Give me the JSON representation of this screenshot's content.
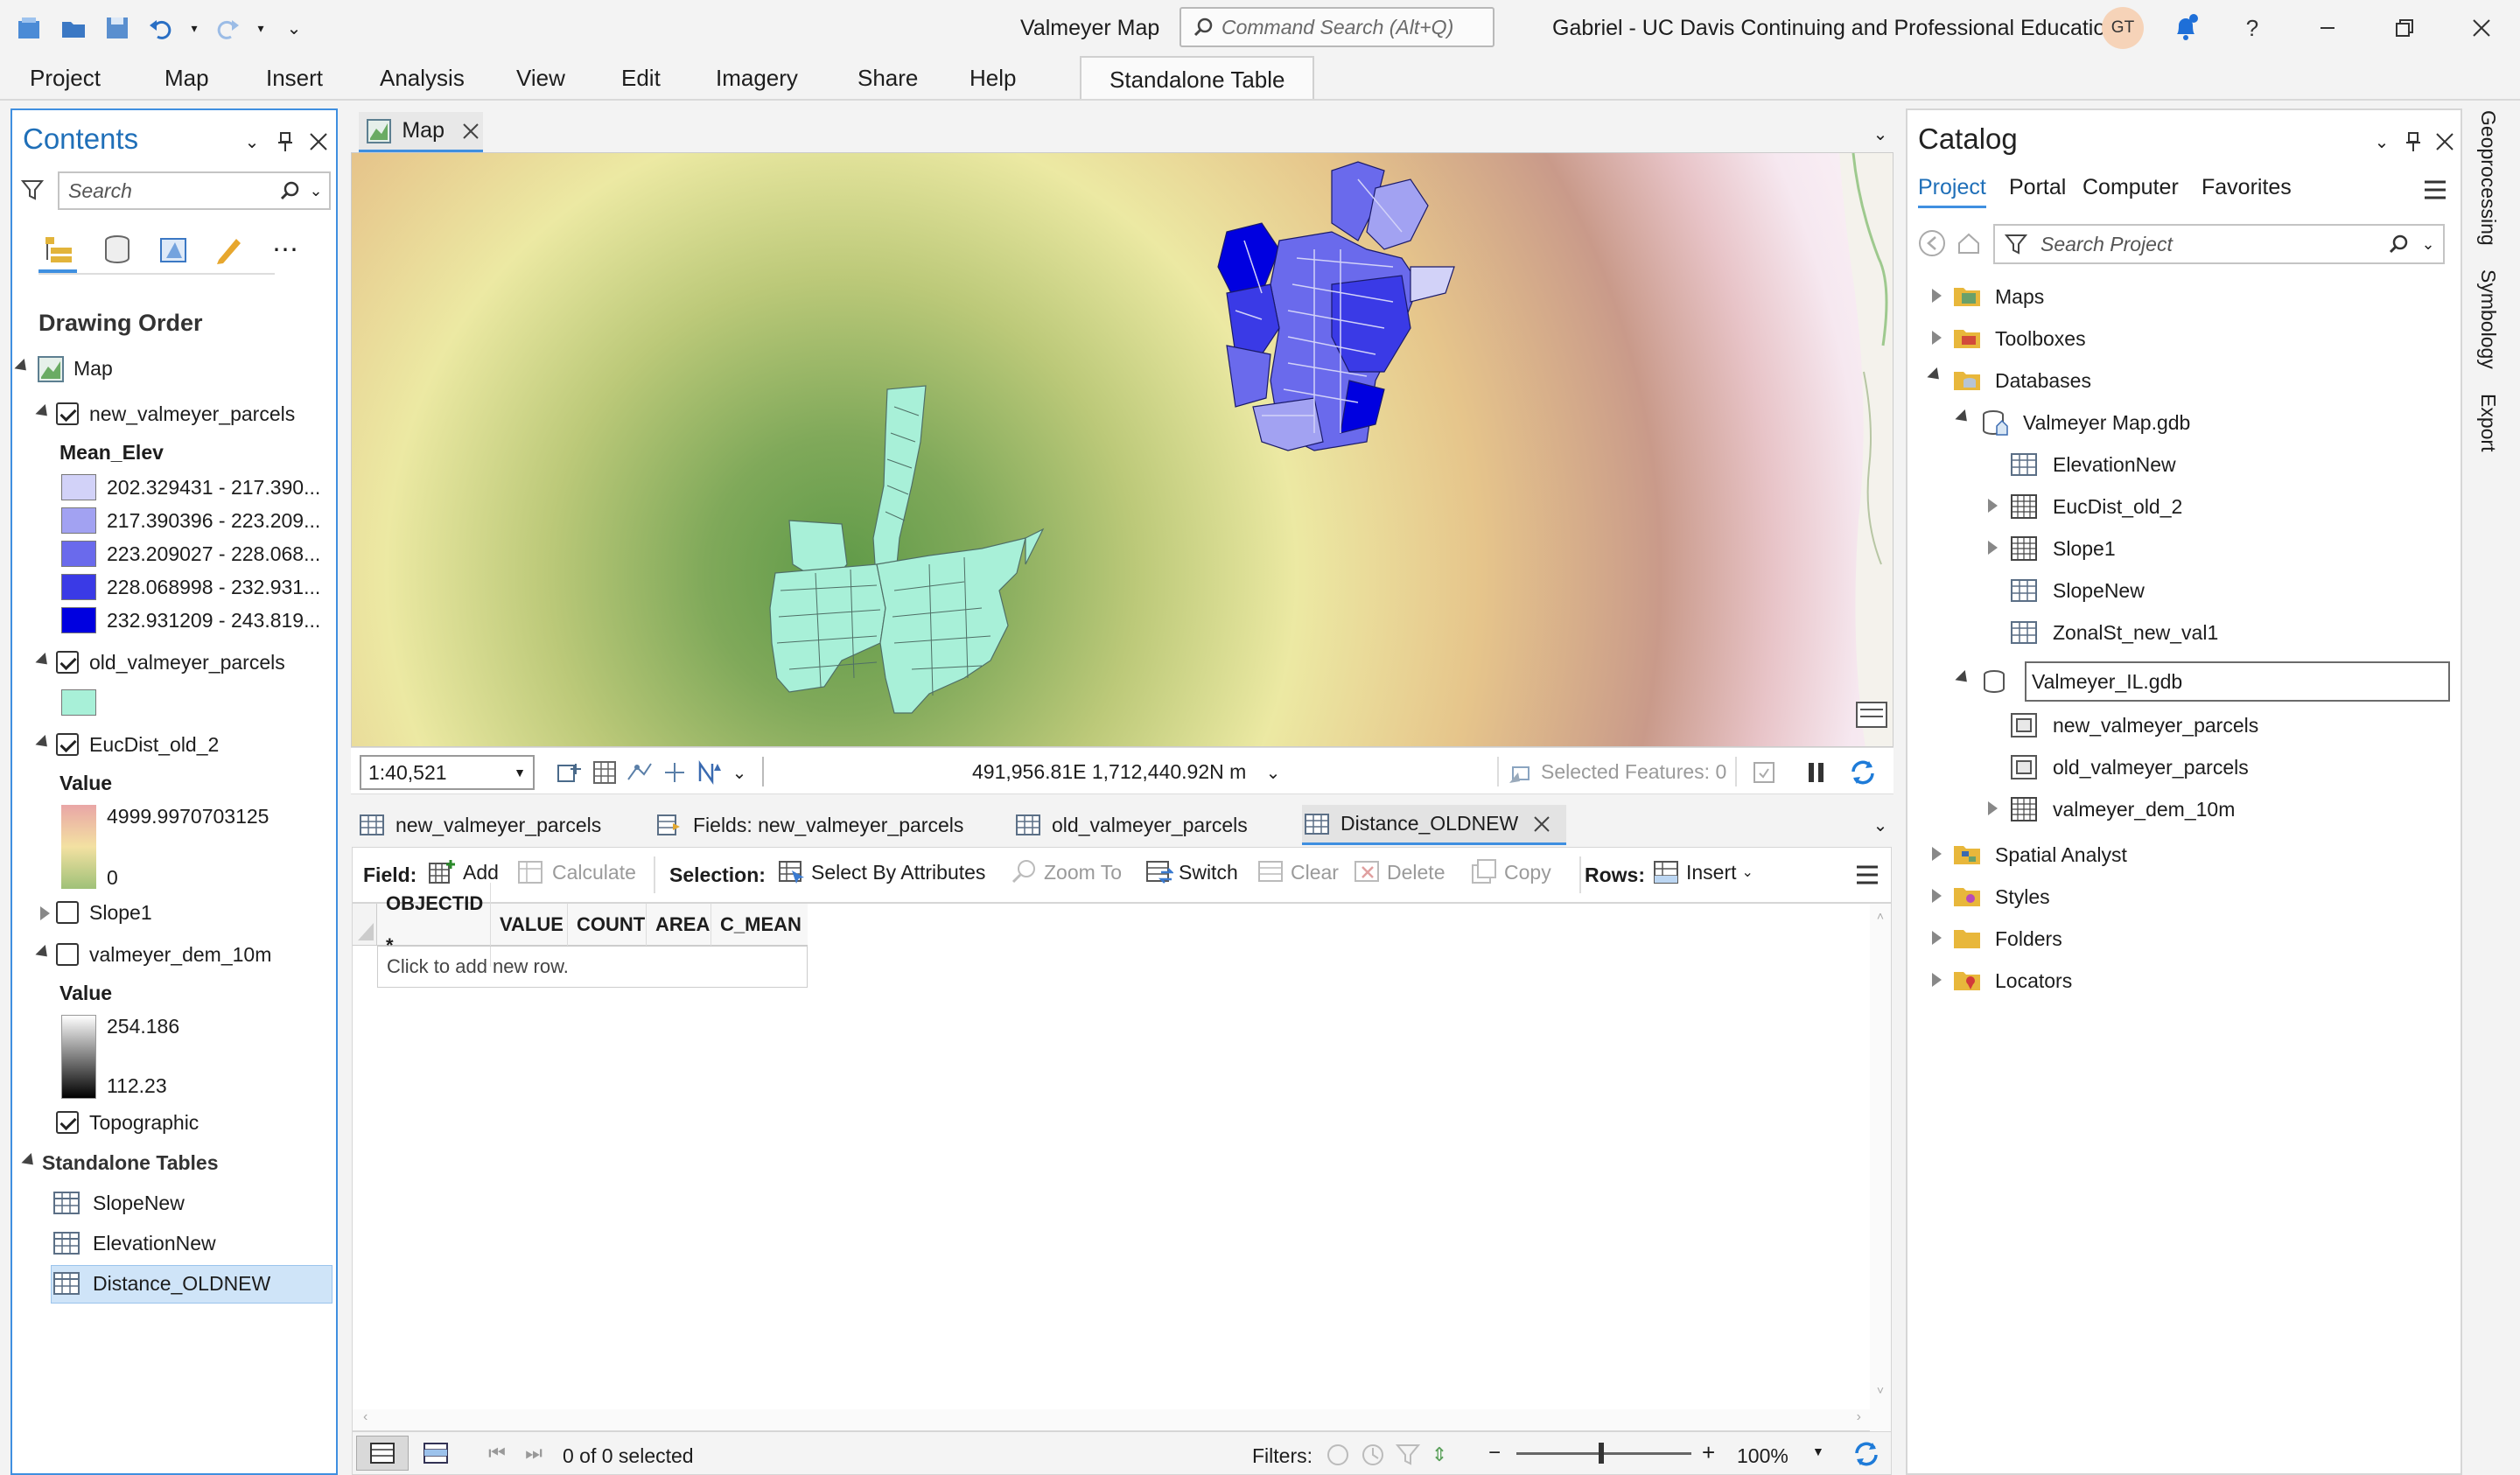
{
  "window": {
    "app_title": "Valmeyer Map",
    "command_search_placeholder": "Command Search (Alt+Q)",
    "user_name": "Gabriel - UC Davis Continuing and Professional Education",
    "user_initials": "GT"
  },
  "ribbon": {
    "tabs": [
      "Project",
      "Map",
      "Insert",
      "Analysis",
      "View",
      "Edit",
      "Imagery",
      "Share",
      "Help"
    ],
    "contextual_tab": "Standalone Table"
  },
  "contents": {
    "title": "Contents",
    "search_placeholder": "Search",
    "drawing_order": "Drawing Order",
    "map_label": "Map",
    "layers": {
      "new_parcels": {
        "name": "new_valmeyer_parcels",
        "field": "Mean_Elev",
        "classes": [
          {
            "label": "202.329431 - 217.390...",
            "color": "#d2d2f8"
          },
          {
            "label": "217.390396 - 223.209...",
            "color": "#a2a2f2"
          },
          {
            "label": "223.209027 - 228.068...",
            "color": "#6a6aec"
          },
          {
            "label": "228.068998 - 232.931...",
            "color": "#3a3ae6"
          },
          {
            "label": "232.931209 - 243.819...",
            "color": "#0000e0"
          }
        ]
      },
      "old_parcels": {
        "name": "old_valmeyer_parcels",
        "color": "#a8f0d8"
      },
      "eucdist": {
        "name": "EucDist_old_2",
        "value_label": "Value",
        "high": "4999.9970703125",
        "low": "0"
      },
      "slope": {
        "name": "Slope1"
      },
      "dem": {
        "name": "valmeyer_dem_10m",
        "value_label": "Value",
        "high": "254.186",
        "low": "112.23"
      },
      "topo": {
        "name": "Topographic"
      }
    },
    "standalone_tables_label": "Standalone Tables",
    "standalone_tables": [
      "SlopeNew",
      "ElevationNew",
      "Distance_OLDNEW"
    ]
  },
  "map_view": {
    "tab_label": "Map",
    "scale": "1:40,521",
    "coordinates": "491,956.81E 1,712,440.92N m",
    "selected_features": "Selected Features: 0"
  },
  "table_view": {
    "tabs": [
      "new_valmeyer_parcels",
      "Fields: new_valmeyer_parcels",
      "old_valmeyer_parcels",
      "Distance_OLDNEW"
    ],
    "toolbar": {
      "field_label": "Field:",
      "add": "Add",
      "calculate": "Calculate",
      "selection_label": "Selection:",
      "select_by_attributes": "Select By Attributes",
      "zoom_to": "Zoom To",
      "switch": "Switch",
      "clear": "Clear",
      "delete": "Delete",
      "copy": "Copy",
      "rows_label": "Rows:",
      "insert": "Insert"
    },
    "columns": [
      "OBJECTID *",
      "VALUE",
      "COUNT",
      "AREA",
      "C_MEAN"
    ],
    "new_row_hint": "Click to add new row.",
    "footer": {
      "selection_count": "0 of 0 selected",
      "filters_label": "Filters:",
      "zoom_level": "100%"
    }
  },
  "catalog": {
    "title": "Catalog",
    "tabs": [
      "Project",
      "Portal",
      "Computer",
      "Favorites"
    ],
    "search_placeholder": "Search Project",
    "items": {
      "maps": "Maps",
      "toolboxes": "Toolboxes",
      "databases": "Databases",
      "gdb1": "Valmeyer Map.gdb",
      "gdb1_children": [
        "ElevationNew",
        "EucDist_old_2",
        "Slope1",
        "SlopeNew",
        "ZonalSt_new_val1"
      ],
      "gdb2": "Valmeyer_IL.gdb",
      "gdb2_children": [
        "new_valmeyer_parcels",
        "old_valmeyer_parcels",
        "valmeyer_dem_10m"
      ],
      "spatial_analyst": "Spatial Analyst",
      "styles": "Styles",
      "folders": "Folders",
      "locators": "Locators"
    }
  },
  "side_tabs": [
    "Geoprocessing",
    "Symbology",
    "Export"
  ]
}
